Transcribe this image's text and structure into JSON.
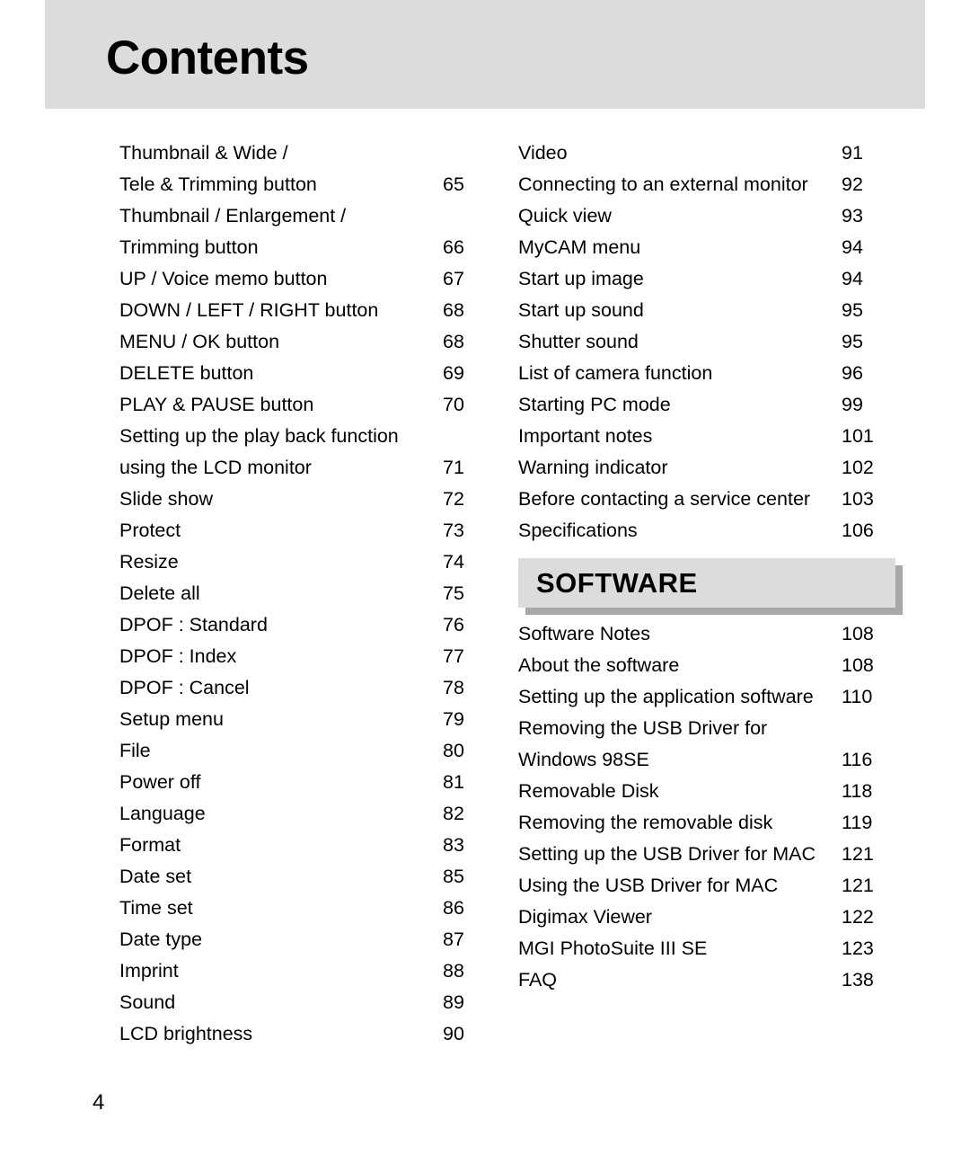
{
  "page": {
    "title": "Contents",
    "folio": "4",
    "header_bg": "#dcdcdc",
    "shadow_color": "#a8a8a8",
    "text_color": "#000000"
  },
  "left_column": {
    "entries": [
      {
        "label": "Thumbnail & Wide /",
        "page": ""
      },
      {
        "label": "Tele & Trimming button",
        "page": "65"
      },
      {
        "label": "Thumbnail / Enlargement /",
        "page": ""
      },
      {
        "label": "Trimming button",
        "page": "66"
      },
      {
        "label": "UP / Voice memo button",
        "page": "67"
      },
      {
        "label": "DOWN / LEFT / RIGHT button",
        "page": "68"
      },
      {
        "label": "MENU / OK button",
        "page": "68"
      },
      {
        "label": "DELETE button",
        "page": "69"
      },
      {
        "label": "PLAY & PAUSE button",
        "page": "70"
      },
      {
        "label": "Setting up the play back function",
        "page": ""
      },
      {
        "label": "using the LCD monitor",
        "page": "71"
      },
      {
        "label": "Slide show",
        "page": "72"
      },
      {
        "label": "Protect",
        "page": "73"
      },
      {
        "label": "Resize",
        "page": "74"
      },
      {
        "label": "Delete all",
        "page": "75"
      },
      {
        "label": "DPOF : Standard",
        "page": "76"
      },
      {
        "label": "DPOF : Index",
        "page": "77"
      },
      {
        "label": "DPOF : Cancel",
        "page": "78"
      },
      {
        "label": "Setup menu",
        "page": "79"
      },
      {
        "label": "File",
        "page": "80"
      },
      {
        "label": "Power off",
        "page": "81"
      },
      {
        "label": "Language",
        "page": "82"
      },
      {
        "label": "Format",
        "page": "83"
      },
      {
        "label": "Date set",
        "page": "85"
      },
      {
        "label": "Time set",
        "page": "86"
      },
      {
        "label": "Date type",
        "page": "87"
      },
      {
        "label": "Imprint",
        "page": "88"
      },
      {
        "label": "Sound",
        "page": "89"
      },
      {
        "label": "LCD brightness",
        "page": "90"
      }
    ]
  },
  "right_column": {
    "entries_before_section": [
      {
        "label": "Video",
        "page": "91"
      },
      {
        "label": "Connecting to an external monitor",
        "page": "92"
      },
      {
        "label": "Quick view",
        "page": "93"
      },
      {
        "label": "MyCAM menu",
        "page": "94"
      },
      {
        "label": "Start up image",
        "page": "94"
      },
      {
        "label": "Start up sound",
        "page": "95"
      },
      {
        "label": "Shutter sound",
        "page": "95"
      },
      {
        "label": "List of camera function",
        "page": "96"
      },
      {
        "label": "Starting PC mode",
        "page": "99"
      },
      {
        "label": "Important notes",
        "page": "101"
      },
      {
        "label": "Warning indicator",
        "page": "102"
      },
      {
        "label": "Before contacting a service center",
        "page": "103"
      },
      {
        "label": "Specifications",
        "page": "106"
      }
    ],
    "section_banner": {
      "label": "SOFTWARE"
    },
    "entries_after_section": [
      {
        "label": "Software Notes",
        "page": "108"
      },
      {
        "label": "About the software",
        "page": "108"
      },
      {
        "label": "Setting up the application software",
        "page": "110"
      },
      {
        "label": "Removing the USB Driver for",
        "page": ""
      },
      {
        "label": "Windows 98SE",
        "page": "116"
      },
      {
        "label": "Removable Disk",
        "page": "118"
      },
      {
        "label": "Removing the removable disk",
        "page": "119"
      },
      {
        "label": "Setting up the USB Driver for MAC",
        "page": "121"
      },
      {
        "label": "Using the USB Driver for MAC",
        "page": "121"
      },
      {
        "label": "Digimax Viewer",
        "page": "122"
      },
      {
        "label": "MGI PhotoSuite III SE",
        "page": "123"
      },
      {
        "label": "FAQ",
        "page": "138"
      }
    ]
  }
}
